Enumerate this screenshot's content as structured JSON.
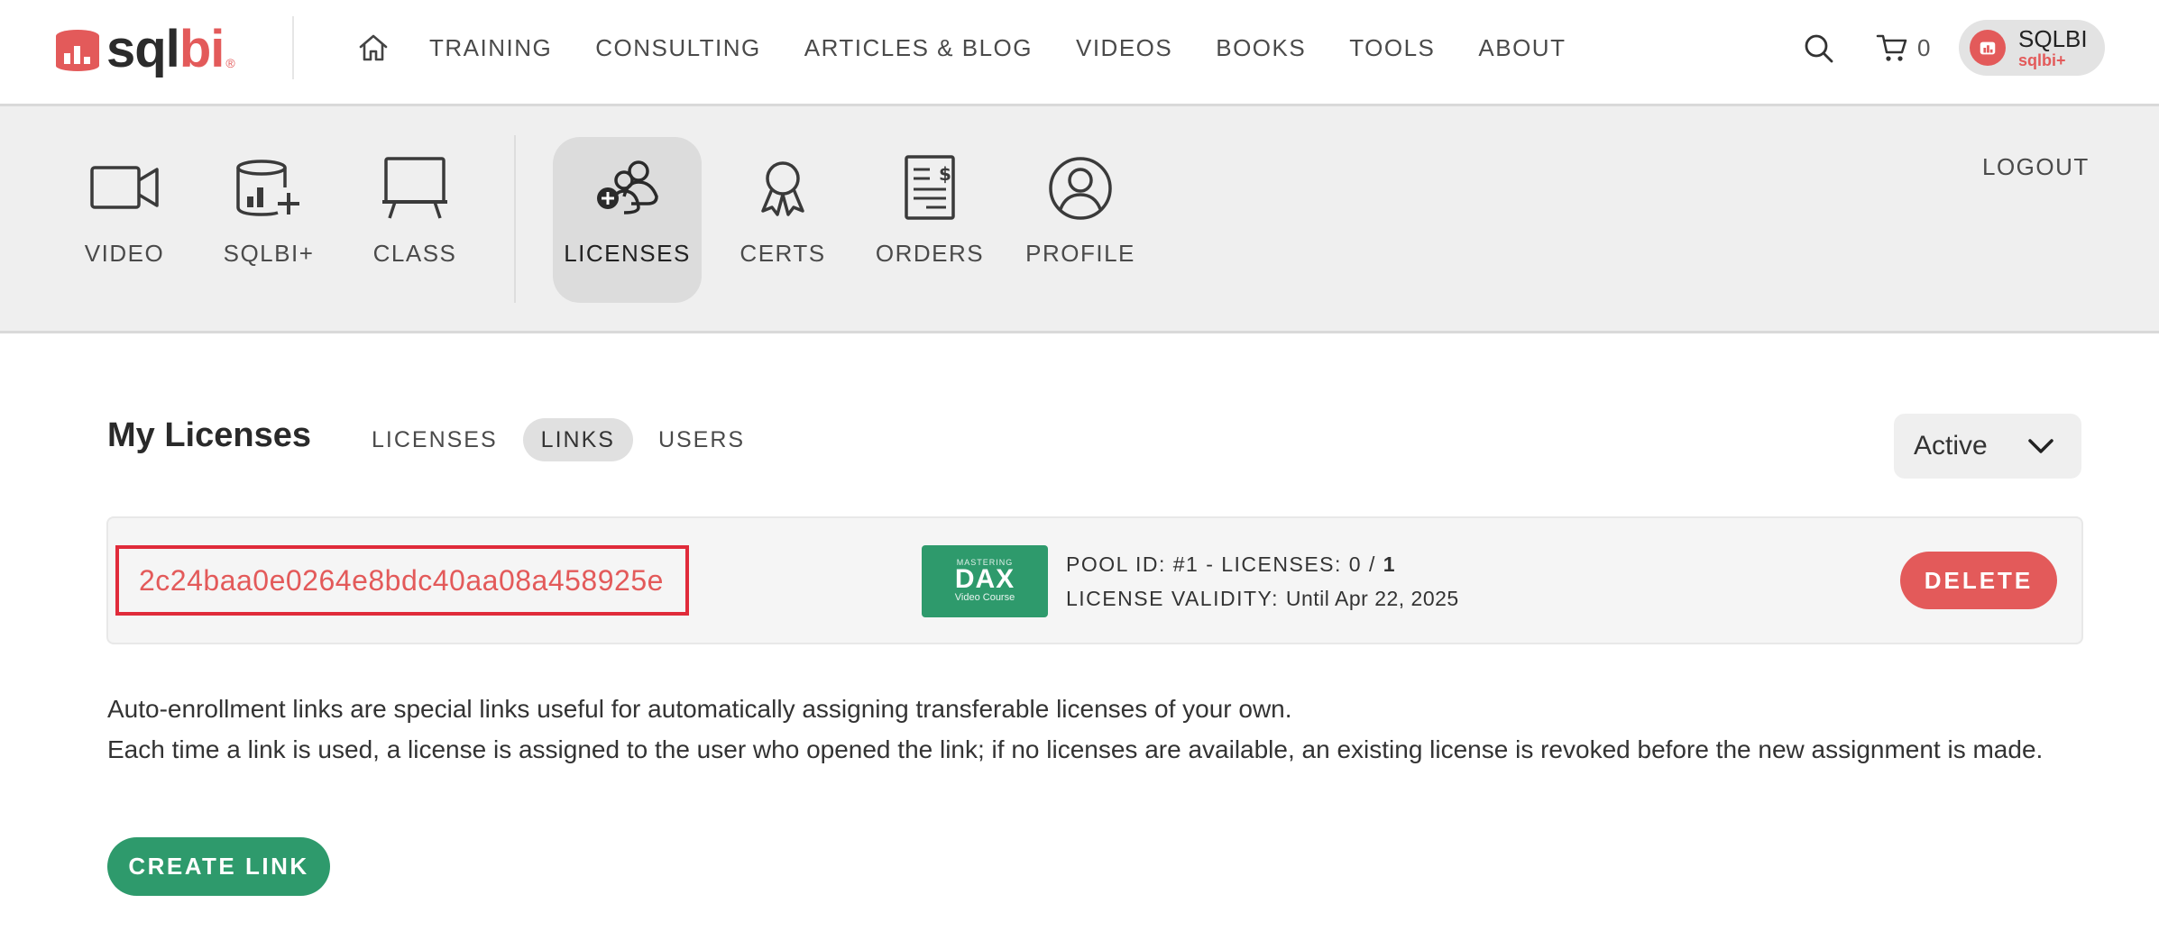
{
  "brand": {
    "logo_sq": "sql",
    "logo_bi": "bi",
    "logo_reg": "®"
  },
  "topnav": {
    "items": [
      "TRAINING",
      "CONSULTING",
      "ARTICLES & BLOG",
      "VIDEOS",
      "BOOKS",
      "TOOLS",
      "ABOUT"
    ],
    "cart_count": "0",
    "user_name": "SQLBI",
    "user_plan": "sqlbi+"
  },
  "subnav": {
    "items": [
      {
        "label": "VIDEO",
        "icon": "video-camera-icon"
      },
      {
        "label": "SQLBI+",
        "icon": "sqlbi-plus-icon"
      },
      {
        "label": "CLASS",
        "icon": "whiteboard-icon"
      },
      {
        "label": "LICENSES",
        "icon": "users-add-icon",
        "active": true
      },
      {
        "label": "CERTS",
        "icon": "award-ribbon-icon"
      },
      {
        "label": "ORDERS",
        "icon": "invoice-icon"
      },
      {
        "label": "PROFILE",
        "icon": "user-circle-icon"
      }
    ],
    "logout": "LOGOUT"
  },
  "main": {
    "title": "My Licenses",
    "tabs": [
      {
        "label": "LICENSES",
        "active": false
      },
      {
        "label": "LINKS",
        "active": true
      },
      {
        "label": "USERS",
        "active": false
      }
    ],
    "filter": {
      "selected": "Active"
    },
    "links": [
      {
        "id": "2c24baa0e0264e8bdc40aa08a458925e",
        "course": {
          "line1": "MASTERING",
          "line2": "DAX",
          "line3": "Video Course"
        },
        "pool_text": "POOL ID: #1 - LICENSES: 0 / ",
        "pool_total": "1",
        "validity_label": "LICENSE VALIDITY: ",
        "validity_value": "Until Apr 22, 2025",
        "delete_label": "DELETE"
      }
    ],
    "description": [
      "Auto-enrollment links are special links useful for automatically assigning transferable licenses of your own.",
      "Each time a link is used, a license is assigned to the user who opened the link; if no licenses are available, an existing license is revoked before the new assignment is made."
    ],
    "create_label": "CREATE LINK"
  },
  "colors": {
    "brand_red": "#e35a5a",
    "highlight_red": "#e02b3a",
    "action_green": "#2e9a6c",
    "nav_bg": "#efefef"
  }
}
